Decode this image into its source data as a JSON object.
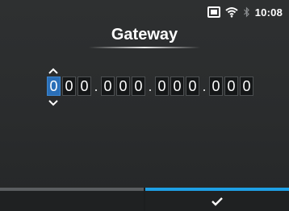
{
  "status_bar": {
    "time": "10:08",
    "icons": [
      "storage-card-icon",
      "wifi-icon",
      "bluetooth-icon"
    ]
  },
  "screen": {
    "title": "Gateway"
  },
  "gateway": {
    "octets": [
      [
        "0",
        "0",
        "0"
      ],
      [
        "0",
        "0",
        "0"
      ],
      [
        "0",
        "0",
        "0"
      ],
      [
        "0",
        "0",
        "0"
      ]
    ],
    "separator": ".",
    "active_digit": "octet-1-digit-1"
  },
  "softkeys": {
    "left": {
      "label": ""
    },
    "right": {
      "icon": "checkmark-icon"
    }
  },
  "colors": {
    "accent": "#1ea0e6",
    "active_digit": "#2a6fb8",
    "background": "#2b2d2e"
  }
}
